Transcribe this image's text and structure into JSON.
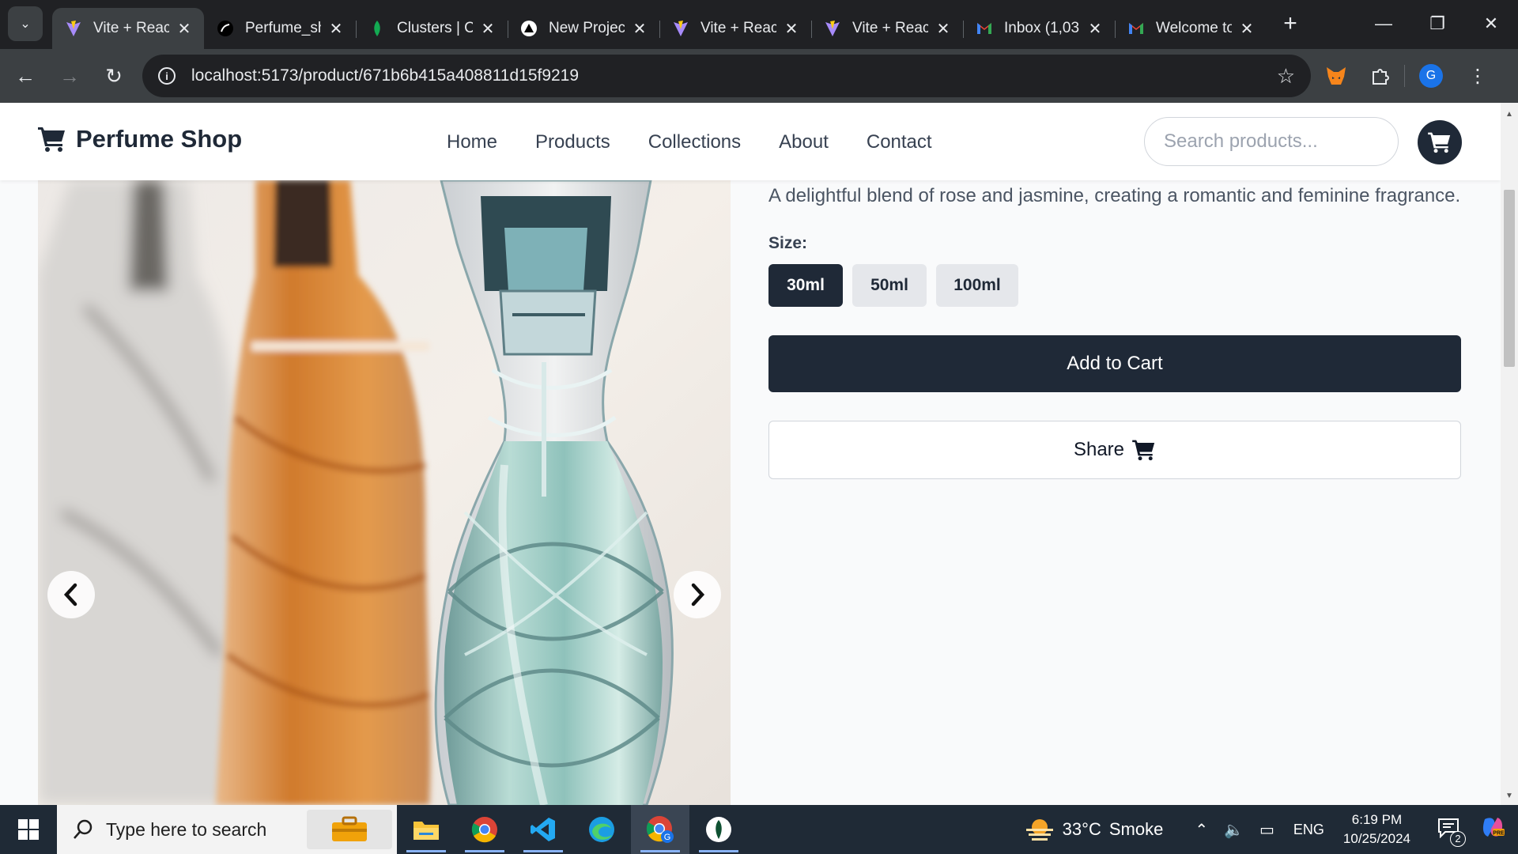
{
  "browser": {
    "tabs": [
      {
        "title": "Vite + React",
        "icon": "vite-icon",
        "active": true
      },
      {
        "title": "Perfume_shop",
        "icon": "github-icon",
        "active": false
      },
      {
        "title": "Clusters | Cloud",
        "icon": "mongodb-icon",
        "active": false
      },
      {
        "title": "New Project",
        "icon": "vercel-icon",
        "active": false
      },
      {
        "title": "Vite + React",
        "icon": "vite-icon",
        "active": false
      },
      {
        "title": "Vite + React",
        "icon": "vite-icon",
        "active": false
      },
      {
        "title": "Inbox (1,03",
        "icon": "gmail-icon",
        "active": false
      },
      {
        "title": "Welcome to",
        "icon": "gmail-icon",
        "active": false
      }
    ],
    "url": "localhost:5173/product/671b6b415a408811d15f9219",
    "profile_initial": "G"
  },
  "site": {
    "brand": "Perfume Shop",
    "nav": [
      "Home",
      "Products",
      "Collections",
      "About",
      "Contact"
    ],
    "search_placeholder": "Search products..."
  },
  "product": {
    "description": "A delightful blend of rose and jasmine, creating a romantic and feminine fragrance.",
    "size_label": "Size:",
    "sizes": [
      "30ml",
      "50ml",
      "100ml"
    ],
    "selected_size": "30ml",
    "add_to_cart": "Add to Cart",
    "share": "Share"
  },
  "taskbar": {
    "search_placeholder": "Type here to search",
    "weather": {
      "temp": "33°C",
      "condition": "Smoke"
    },
    "language": "ENG",
    "time": "6:19 PM",
    "date": "10/25/2024",
    "notification_count": "2"
  },
  "colors": {
    "primary": "#1f2937",
    "page_bg": "#f9fafb",
    "chrome_dark": "#202124",
    "chrome_toolbar": "#3c4043"
  }
}
